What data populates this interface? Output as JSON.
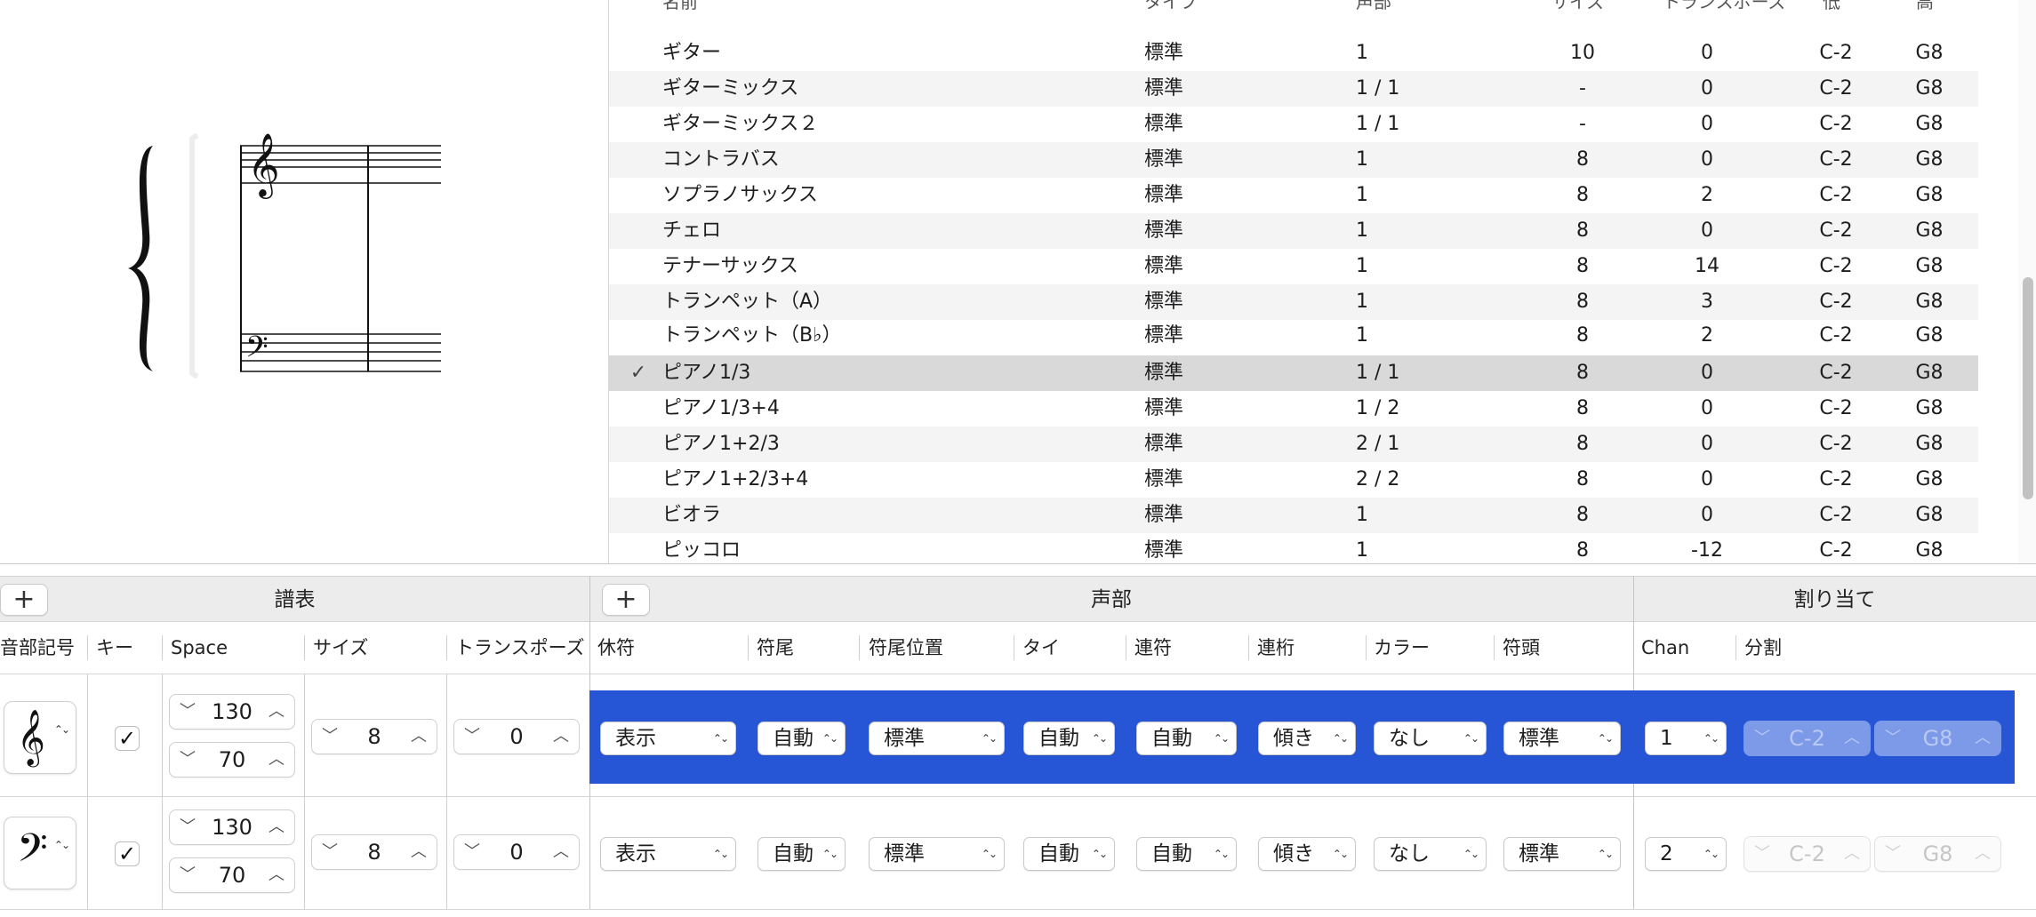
{
  "instrument_list": {
    "header_cut": [
      "名前",
      "タイプ",
      "声部",
      "サイズ",
      "トランスポーズ",
      "低",
      "高"
    ],
    "rows": [
      {
        "check": "",
        "name": "ギター",
        "type": "標準",
        "voice": "1",
        "size": "10",
        "transpose": "0",
        "low": "C-2",
        "high": "G8"
      },
      {
        "check": "",
        "name": "ギターミックス",
        "type": "標準",
        "voice": "1 / 1",
        "size": "-",
        "transpose": "0",
        "low": "C-2",
        "high": "G8"
      },
      {
        "check": "",
        "name": "ギターミックス２",
        "type": "標準",
        "voice": "1 / 1",
        "size": "-",
        "transpose": "0",
        "low": "C-2",
        "high": "G8"
      },
      {
        "check": "",
        "name": "コントラバス",
        "type": "標準",
        "voice": "1",
        "size": "8",
        "transpose": "0",
        "low": "C-2",
        "high": "G8"
      },
      {
        "check": "",
        "name": "ソプラノサックス",
        "type": "標準",
        "voice": "1",
        "size": "8",
        "transpose": "2",
        "low": "C-2",
        "high": "G8"
      },
      {
        "check": "",
        "name": "チェロ",
        "type": "標準",
        "voice": "1",
        "size": "8",
        "transpose": "0",
        "low": "C-2",
        "high": "G8"
      },
      {
        "check": "",
        "name": "テナーサックス",
        "type": "標準",
        "voice": "1",
        "size": "8",
        "transpose": "14",
        "low": "C-2",
        "high": "G8"
      },
      {
        "check": "",
        "name": "トランペット（A）",
        "type": "標準",
        "voice": "1",
        "size": "8",
        "transpose": "3",
        "low": "C-2",
        "high": "G8"
      },
      {
        "check": "",
        "name": "トランペット（B♭）",
        "type": "標準",
        "voice": "1",
        "size": "8",
        "transpose": "2",
        "low": "C-2",
        "high": "G8"
      },
      {
        "check": "✓",
        "name": "ピアノ1/3",
        "type": "標準",
        "voice": "1 / 1",
        "size": "8",
        "transpose": "0",
        "low": "C-2",
        "high": "G8"
      },
      {
        "check": "",
        "name": "ピアノ1/3+4",
        "type": "標準",
        "voice": "1 / 2",
        "size": "8",
        "transpose": "0",
        "low": "C-2",
        "high": "G8"
      },
      {
        "check": "",
        "name": "ピアノ1+2/3",
        "type": "標準",
        "voice": "2 / 1",
        "size": "8",
        "transpose": "0",
        "low": "C-2",
        "high": "G8"
      },
      {
        "check": "",
        "name": "ピアノ1+2/3+4",
        "type": "標準",
        "voice": "2 / 2",
        "size": "8",
        "transpose": "0",
        "low": "C-2",
        "high": "G8"
      },
      {
        "check": "",
        "name": "ビオラ",
        "type": "標準",
        "voice": "1",
        "size": "8",
        "transpose": "0",
        "low": "C-2",
        "high": "G8"
      },
      {
        "check": "",
        "name": "ピッコロ",
        "type": "標準",
        "voice": "1",
        "size": "8",
        "transpose": "-12",
        "low": "C-2",
        "high": "G8"
      }
    ]
  },
  "panels": {
    "staff": {
      "title": "譜表",
      "plus": "+",
      "columns": [
        "音部記号",
        "キー",
        "Space",
        "サイズ",
        "トランスポーズ"
      ]
    },
    "voice": {
      "title": "声部",
      "plus": "+",
      "columns": [
        "休符",
        "符尾",
        "符尾位置",
        "タイ",
        "連符",
        "連桁",
        "カラー",
        "符頭"
      ]
    },
    "assign": {
      "title": "割り当て",
      "columns": [
        "Chan",
        "分割"
      ]
    }
  },
  "staff_rows": [
    {
      "clef": "𝄞",
      "key_checked": "✓",
      "space_top": "130",
      "space_bottom": "70",
      "size": "8",
      "transpose": "0",
      "rest": "表示",
      "stem": "自動",
      "stem_pos": "標準",
      "tie": "自動",
      "tuplet": "自動",
      "beam": "傾き",
      "color": "なし",
      "head": "標準",
      "chan": "1",
      "split_low": "C-2",
      "split_high": "G8"
    },
    {
      "clef": "𝄢",
      "key_checked": "✓",
      "space_top": "130",
      "space_bottom": "70",
      "size": "8",
      "transpose": "0",
      "rest": "表示",
      "stem": "自動",
      "stem_pos": "標準",
      "tie": "自動",
      "tuplet": "自動",
      "beam": "傾き",
      "color": "なし",
      "head": "標準",
      "chan": "2",
      "split_low": "C-2",
      "split_high": "G8"
    }
  ],
  "glyphs": {
    "down": "﹀",
    "up": "︿",
    "updown": "⌃⌄",
    "treble": "𝄞",
    "bass": "𝄢"
  },
  "colors": {
    "selection_blue": "#2655d6",
    "selected_row": "#d9d9d9",
    "alt_row": "#f4f4f4"
  }
}
